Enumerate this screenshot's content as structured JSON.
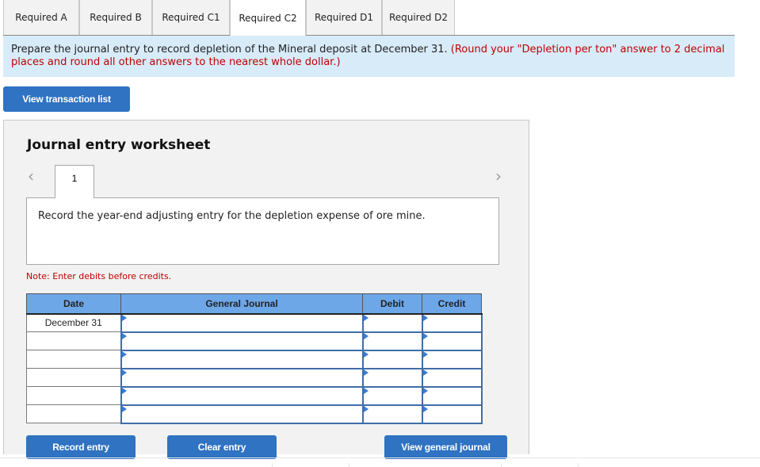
{
  "tabs": [
    {
      "label": "Required A",
      "active": false
    },
    {
      "label": "Required B",
      "active": false
    },
    {
      "label": "Required C1",
      "active": false
    },
    {
      "label": "Required C2",
      "active": true
    },
    {
      "label": "Required D1",
      "active": false
    },
    {
      "label": "Required D2",
      "active": false
    }
  ],
  "instruction": {
    "main": "Prepare the journal entry to record depletion of the Mineral deposit at December 31. ",
    "note": "(Round your \"Depletion per ton\" answer to 2 decimal places and round all other answers to the nearest whole dollar.)"
  },
  "buttons": {
    "view_transaction_list": "View transaction list",
    "record_entry": "Record entry",
    "clear_entry": "Clear entry",
    "view_general_journal": "View general journal"
  },
  "worksheet": {
    "title": "Journal entry worksheet",
    "prev_icon": "chevron-left-icon",
    "next_icon": "chevron-right-icon",
    "page_tab": "1",
    "description": "Record the year-end adjusting entry for the depletion expense of ore mine.",
    "note": "Note: Enter debits before credits."
  },
  "table": {
    "headers": [
      "Date",
      "General Journal",
      "Debit",
      "Credit"
    ],
    "rows": [
      {
        "date": "December 31",
        "account": "",
        "debit": "",
        "credit": ""
      },
      {
        "date": "",
        "account": "",
        "debit": "",
        "credit": ""
      },
      {
        "date": "",
        "account": "",
        "debit": "",
        "credit": ""
      },
      {
        "date": "",
        "account": "",
        "debit": "",
        "credit": ""
      },
      {
        "date": "",
        "account": "",
        "debit": "",
        "credit": ""
      },
      {
        "date": "",
        "account": "",
        "debit": "",
        "credit": ""
      }
    ]
  }
}
